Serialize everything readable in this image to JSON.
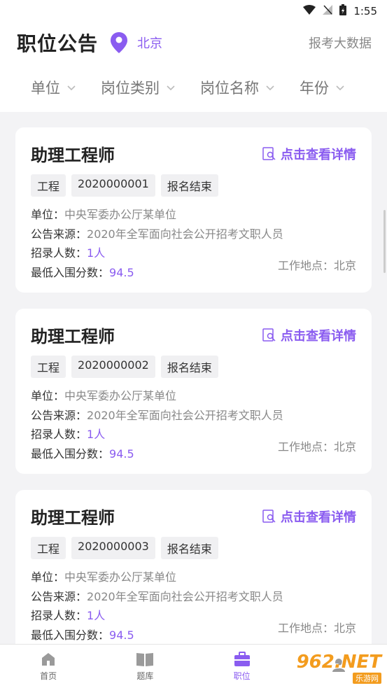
{
  "status_bar": {
    "time": "1:55"
  },
  "header": {
    "title": "职位公告",
    "city": "北京",
    "big_data_link": "报考大数据"
  },
  "filters": [
    {
      "label": "单位"
    },
    {
      "label": "岗位类别"
    },
    {
      "label": "岗位名称"
    },
    {
      "label": "年份"
    }
  ],
  "cards": [
    {
      "job": "助理工程师",
      "detail_link": "点击查看详情",
      "tags": [
        "工程",
        "2020000001",
        "报名结束"
      ],
      "unit_label": "单位：",
      "unit": "中央军委办公厅某单位",
      "source_label": "公告来源：",
      "source": "2020年全军面向社会公开招考文职人员",
      "count_label": "招录人数：",
      "count": "1人",
      "score_label": "最低入围分数：",
      "score": "94.5",
      "location": "工作地点：北京"
    },
    {
      "job": "助理工程师",
      "detail_link": "点击查看详情",
      "tags": [
        "工程",
        "2020000002",
        "报名结束"
      ],
      "unit_label": "单位：",
      "unit": "中央军委办公厅某单位",
      "source_label": "公告来源：",
      "source": "2020年全军面向社会公开招考文职人员",
      "count_label": "招录人数：",
      "count": "1人",
      "score_label": "最低入围分数：",
      "score": "94.5",
      "location": "工作地点：北京"
    },
    {
      "job": "助理工程师",
      "detail_link": "点击查看详情",
      "tags": [
        "工程",
        "2020000003",
        "报名结束"
      ],
      "unit_label": "单位：",
      "unit": "中央军委办公厅某单位",
      "source_label": "公告来源：",
      "source": "2020年全军面向社会公开招考文职人员",
      "count_label": "招录人数：",
      "count": "1人",
      "score_label": "最低入围分数：",
      "score": "94.5",
      "location": "工作地点：北京"
    }
  ],
  "tabbar": [
    {
      "label": "首页",
      "icon": "home-icon"
    },
    {
      "label": "题库",
      "icon": "book-icon"
    },
    {
      "label": "职位",
      "icon": "briefcase-icon",
      "active": true
    },
    {
      "label": "",
      "icon": "user-icon"
    }
  ],
  "watermark": {
    "big": "962.NET",
    "small": "乐游网"
  },
  "colors": {
    "accent": "#8a5cf0",
    "background": "#f3f3f5",
    "tag_bg": "#f0f0f2"
  }
}
